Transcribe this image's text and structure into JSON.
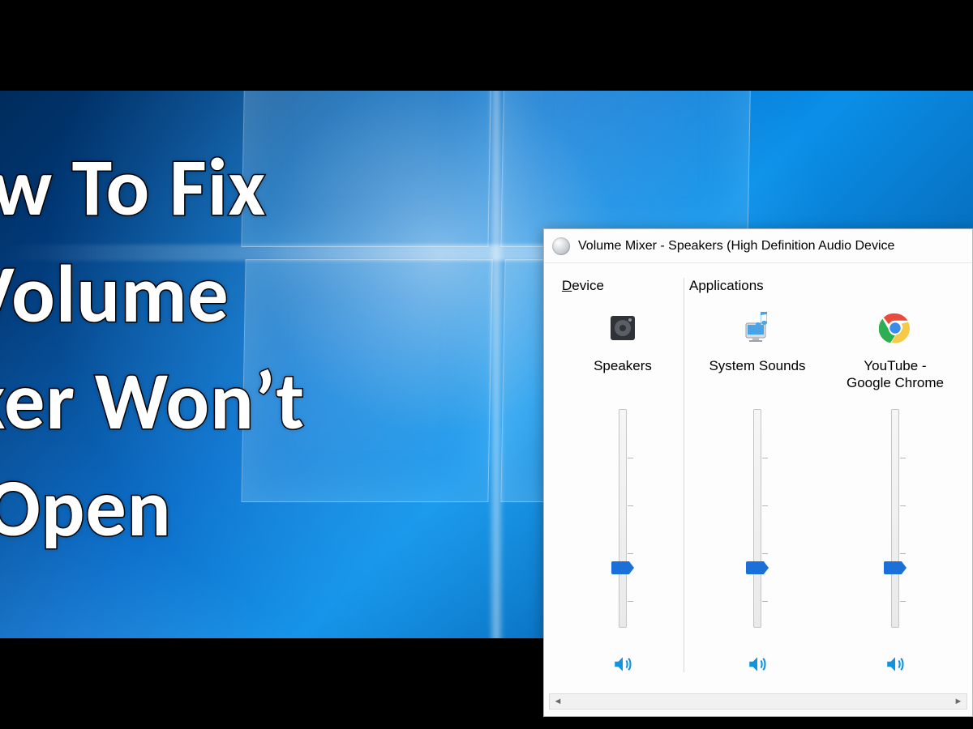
{
  "headline": "ow To Fix\n Volume\nixer Won’t\n  Open",
  "mixer": {
    "title": "Volume Mixer - Speakers (High Definition Audio Device",
    "device_group_label_prefix": "D",
    "device_group_label_rest": "evice",
    "apps_group_label": "Applications",
    "channels": [
      {
        "id": "speakers",
        "label": "Speakers",
        "level_pct": 26,
        "icon": "speaker-device-icon"
      },
      {
        "id": "system-sounds",
        "label": "System Sounds",
        "level_pct": 26,
        "icon": "system-sounds-icon"
      },
      {
        "id": "chrome",
        "label": "YouTube -\nGoogle Chrome",
        "level_pct": 26,
        "icon": "chrome-icon"
      }
    ]
  },
  "colors": {
    "accent": "#1b6fd8",
    "speaker_icon": "#1094e0"
  }
}
